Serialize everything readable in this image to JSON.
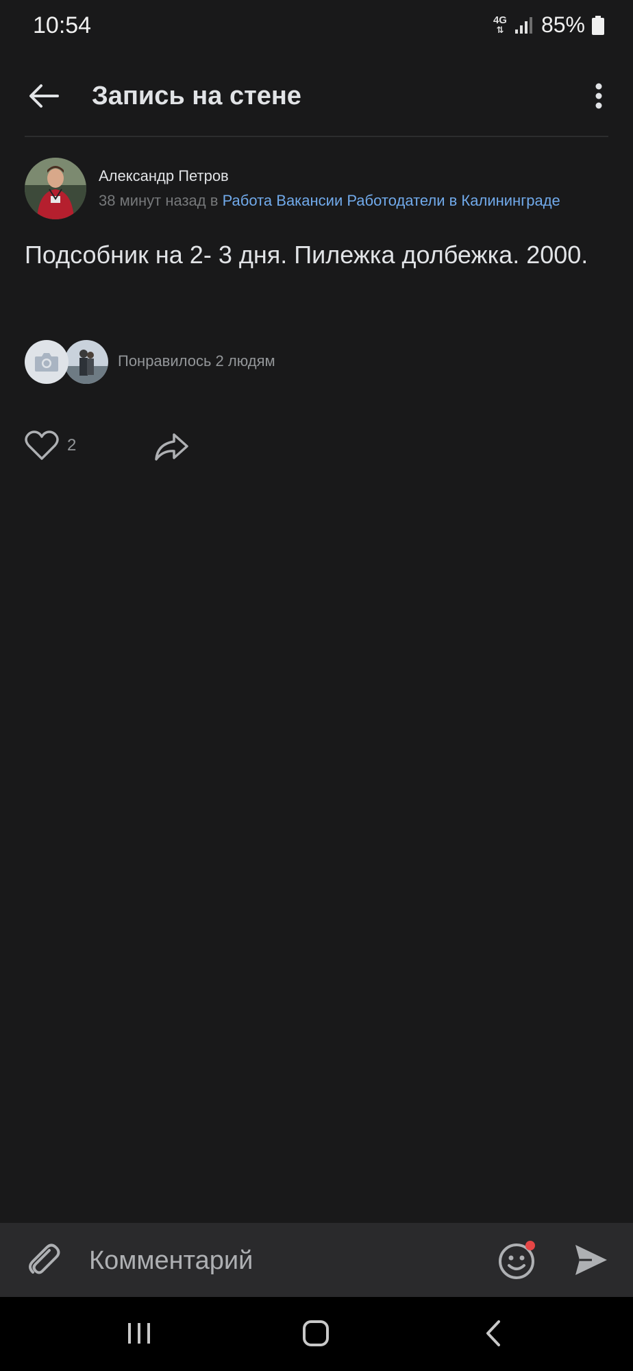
{
  "status_bar": {
    "time": "10:54",
    "network": "4G",
    "battery": "85%"
  },
  "header": {
    "title": "Запись на стене",
    "back_icon": "arrow-left-icon",
    "more_icon": "more-vertical-icon"
  },
  "post": {
    "author_name": "Александр Петров",
    "time_ago": "38 минут назад в",
    "group_name": "Работа Вакансии Работодатели в Калининграде",
    "text": "Подсобник на 2- 3 дня. Пилежка долбежка. 2000.",
    "liked_by_text": "Понравилось 2 людям",
    "like_count": "2"
  },
  "comment_bar": {
    "placeholder": "Комментарий",
    "emoji_has_notification": true
  },
  "colors": {
    "background": "#19191a",
    "link": "#71aaeb",
    "secondary_text": "#76787a",
    "comment_bar": "#2a2a2c",
    "notification_dot": "#e64646"
  }
}
